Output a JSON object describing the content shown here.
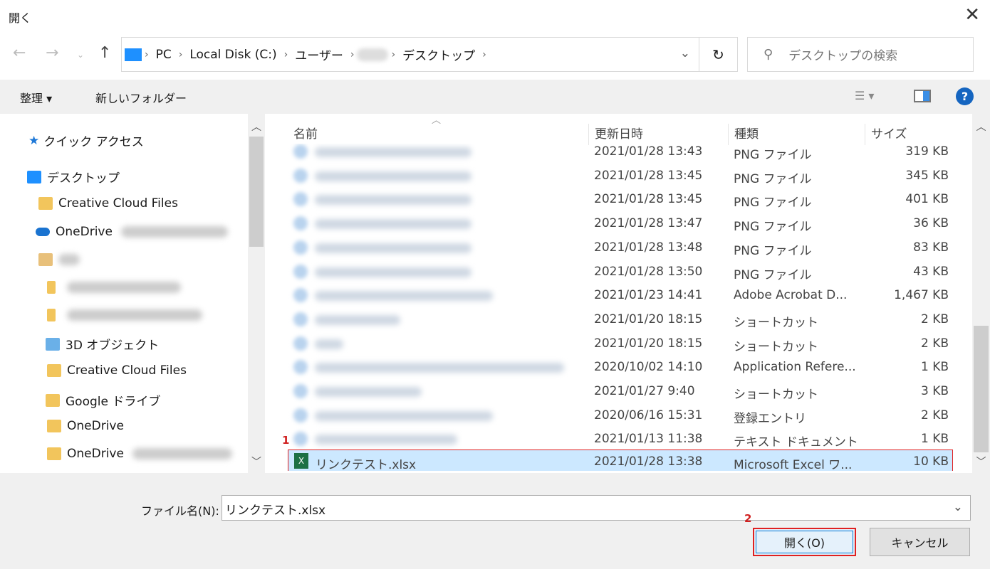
{
  "window": {
    "title": "開く"
  },
  "address": {
    "crumbs": [
      "PC",
      "Local Disk (C:)",
      "ユーザー",
      "デスクトップ"
    ]
  },
  "search": {
    "placeholder": "デスクトップの検索"
  },
  "toolbar": {
    "organize": "整理 ▾",
    "new_folder": "新しいフォルダー"
  },
  "sidebar": {
    "items": [
      "クイック アクセス",
      "デスクトップ",
      "Creative Cloud Files",
      "OneDrive",
      "3D オブジェクト",
      "Creative Cloud Files",
      "Google ドライブ",
      "OneDrive",
      "OneDrive"
    ]
  },
  "columns": [
    "名前",
    "更新日時",
    "種類",
    "サイズ"
  ],
  "files": [
    {
      "date": "2021/01/28 13:43",
      "type": "PNG ファイル",
      "size": "319 KB"
    },
    {
      "date": "2021/01/28 13:45",
      "type": "PNG ファイル",
      "size": "345 KB"
    },
    {
      "date": "2021/01/28 13:45",
      "type": "PNG ファイル",
      "size": "401 KB"
    },
    {
      "date": "2021/01/28 13:47",
      "type": "PNG ファイル",
      "size": "36 KB"
    },
    {
      "date": "2021/01/28 13:48",
      "type": "PNG ファイル",
      "size": "83 KB"
    },
    {
      "date": "2021/01/28 13:50",
      "type": "PNG ファイル",
      "size": "43 KB"
    },
    {
      "date": "2021/01/23 14:41",
      "type": "Adobe Acrobat D...",
      "size": "1,467 KB"
    },
    {
      "date": "2021/01/20 18:15",
      "type": "ショートカット",
      "size": "2 KB"
    },
    {
      "date": "2021/01/20 18:15",
      "type": "ショートカット",
      "size": "2 KB"
    },
    {
      "date": "2020/10/02 14:10",
      "type": "Application Refere...",
      "size": "1 KB"
    },
    {
      "date": "2021/01/27 9:40",
      "type": "ショートカット",
      "size": "3 KB"
    },
    {
      "date": "2020/06/16 15:31",
      "type": "登録エントリ",
      "size": "2 KB"
    },
    {
      "date": "2021/01/13 11:38",
      "type": "テキスト ドキュメント",
      "size": "1 KB"
    }
  ],
  "selected": {
    "name": "リンクテスト.xlsx",
    "date": "2021/01/28 13:38",
    "type": "Microsoft Excel ワ...",
    "size": "10 KB"
  },
  "annotations": [
    "1",
    "2"
  ],
  "footer": {
    "filename_label": "ファイル名(N):",
    "filename_value": "リンクテスト.xlsx",
    "open": "開く(O)",
    "cancel": "キャンセル"
  }
}
